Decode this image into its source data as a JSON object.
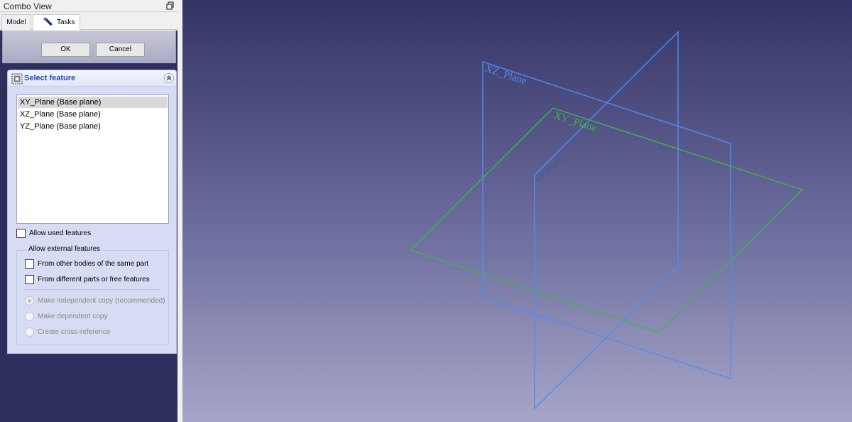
{
  "combo_view": {
    "title": "Combo View",
    "tabs": [
      {
        "label": "Model",
        "active": false
      },
      {
        "label": "Tasks",
        "active": true
      }
    ]
  },
  "task_buttons": {
    "ok_label": "OK",
    "cancel_label": "Cancel"
  },
  "select_feature": {
    "title": "Select feature",
    "list_items": [
      {
        "label": "XY_Plane (Base plane)",
        "selected": true
      },
      {
        "label": "XZ_Plane (Base plane)",
        "selected": false
      },
      {
        "label": "YZ_Plane (Base plane)",
        "selected": false
      }
    ],
    "allow_used_features": {
      "label": "Allow used features",
      "checked": false
    },
    "external_group": {
      "title": "Allow external features",
      "options": [
        {
          "label": "From other bodies of the same part",
          "checked": false
        },
        {
          "label": "From different parts or free features",
          "checked": false
        }
      ],
      "copy_modes": [
        {
          "label": "Make independent copy (recommended)",
          "selected": true,
          "enabled": false
        },
        {
          "label": "Make dependent copy",
          "selected": false,
          "enabled": false
        },
        {
          "label": "Create cross-reference",
          "selected": false,
          "enabled": false
        }
      ]
    }
  },
  "viewport": {
    "plane_labels": {
      "xz": "XZ_Plane",
      "xy": "XY_Plane",
      "yz": "YZ_Plane"
    },
    "colors": {
      "xz_plane": "#4f8df2",
      "yz_plane": "#4f8df2",
      "xy_plane": "#3db64a",
      "bg_top": "#333366",
      "bg_bottom": "#a6a6c8"
    }
  }
}
